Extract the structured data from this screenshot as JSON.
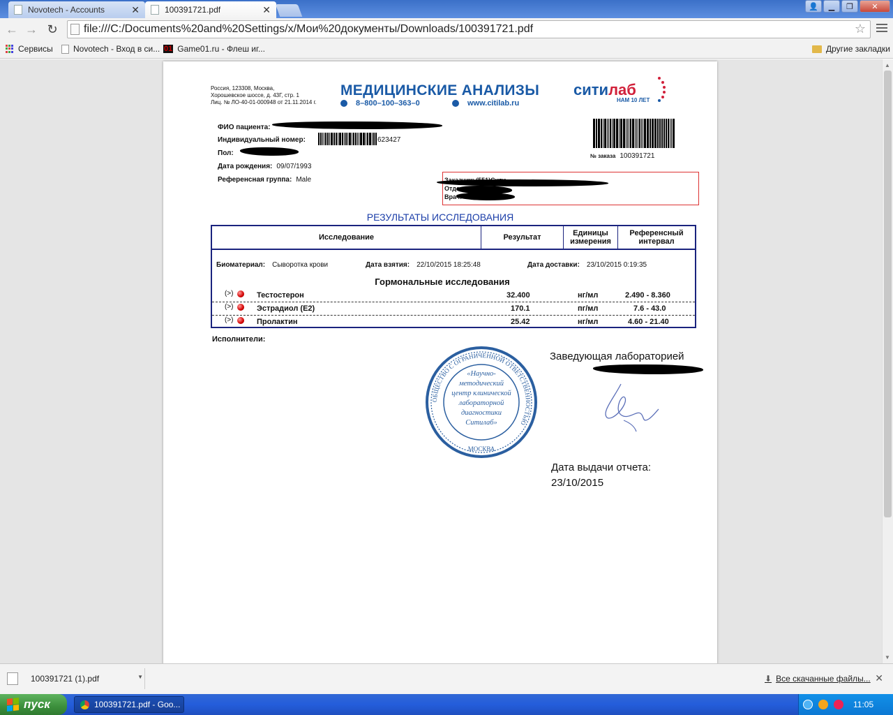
{
  "browser": {
    "tabs": [
      {
        "title": "Novotech - Accounts"
      },
      {
        "title": "100391721.pdf"
      }
    ],
    "url": "file:///C:/Documents%20and%20Settings/x/Мои%20документы/Downloads/100391721.pdf",
    "bookmarks": [
      {
        "label": "Сервисы",
        "icon": "apps-icon"
      },
      {
        "label": "Novotech - Вход в си...",
        "icon": "page-icon"
      },
      {
        "label": "Game01.ru - Флеш иг...",
        "icon": "game01-icon"
      }
    ],
    "other_bookmarks": "Другие закладки"
  },
  "report": {
    "address": [
      "Россия, 123308, Москва,",
      "Хорошевское шоссе, д. 43Г, стр. 1",
      "Лиц. № ЛО-40-01-000948 от 21.11.2014 г."
    ],
    "brand_title": "МЕДИЦИНСКИЕ АНАЛИЗЫ",
    "brand_phone": "8–800–100–363–0",
    "brand_web": "www.citilab.ru",
    "logo_main": "сити",
    "logo_accent": "лаб",
    "logo_sub": "НАМ 10 ЛЕТ",
    "patient": {
      "name_label": "ФИО пациента:",
      "id_label": "Индивидуальный номер:",
      "id_value": "623427",
      "sex_label": "Пол:",
      "dob_label": "Дата рождения:",
      "dob_value": "09/07/1993",
      "refgroup_label": "Референсная группа:",
      "refgroup_value": "Male"
    },
    "order_label": "№ заказа",
    "order_value": "100391721",
    "refbox_lines": [
      "Заказчик: (551)Сити",
      "Отделение: ЦОП",
      "Врач:"
    ],
    "results_title": "РЕЗУЛЬТАТЫ ИССЛЕДОВАНИЯ",
    "table_headers": {
      "test": "Исследование",
      "result": "Результат",
      "units": "Единицы измерения",
      "ref": "Референсный интервал"
    },
    "biomaterial_label": "Биоматериал:",
    "biomaterial_value": "Сыворотка крови",
    "taken_label": "Дата взятия:",
    "taken_value": "22/10/2015 18:25:48",
    "delivered_label": "Дата доставки:",
    "delivered_value": "23/10/2015 0:19:35",
    "section_title": "Гормональные исследования",
    "rows": [
      {
        "flag": "(>)",
        "test": "Тестостерон",
        "result": "32.400",
        "units": "нг/мл",
        "ref": "2.490 - 8.360"
      },
      {
        "flag": "(>)",
        "test": "Эстрадиол (E2)",
        "result": "170.1",
        "units": "пг/мл",
        "ref": "7.6 - 43.0"
      },
      {
        "flag": "(>)",
        "test": "Пролактин",
        "result": "25.42",
        "units": "нг/мл",
        "ref": "4.60 - 21.40"
      }
    ],
    "executors_label": "Исполнители:",
    "head_lab_label": "Заведующая лабораторией",
    "stamp_lines": [
      "«Научно-",
      "методический",
      "центр клинической",
      "лабораторной",
      "диагностики",
      "Ситилаб»"
    ],
    "stamp_ring": "ОБЩЕСТВО С ОГРАНИЧЕННОЙ ОТВЕТСТВЕННОСТЬЮ",
    "stamp_city": "МОСКВА",
    "issue_label": "Дата выдачи отчета:",
    "issue_date": "23/10/2015"
  },
  "downloads": {
    "item": "100391721 (1).pdf",
    "all_label": "Все скачанные файлы..."
  },
  "taskbar": {
    "start_label": "пуск",
    "window_label": "100391721.pdf - Goo...",
    "lang": "RU",
    "time": "11:05"
  }
}
